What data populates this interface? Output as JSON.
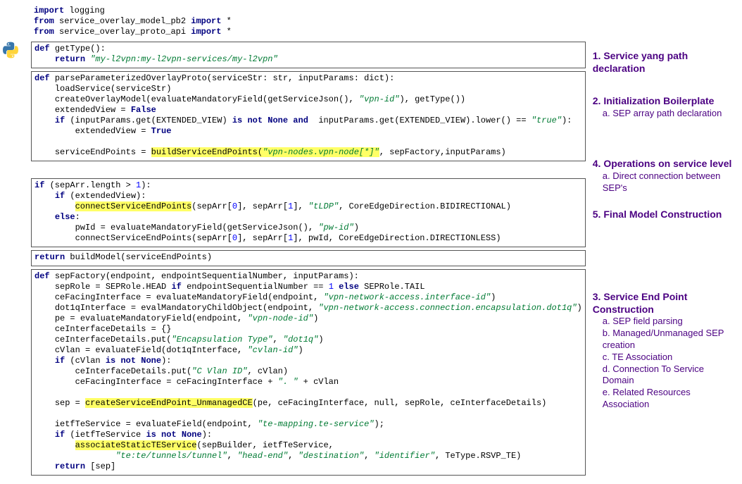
{
  "imports": {
    "l1": {
      "kw1": "import",
      "m": " logging"
    },
    "l2": {
      "kw1": "from",
      "m": " service_overlay_model_pb2 ",
      "kw2": "import",
      "star": " *"
    },
    "l3": {
      "kw1": "from",
      "m": " service_overlay_proto_api ",
      "kw2": "import",
      "star": " *"
    }
  },
  "box1": {
    "def": "def ",
    "fn": "getType",
    "sig": "():",
    "ret_kw": "return ",
    "ret_str": "\"my-l2vpn:my-l2vpn-services/my-l2vpn\""
  },
  "box2": {
    "def": "def ",
    "fn": "parseParameterizedOverlayProto",
    "sig": "(serviceStr: str, inputParams: dict):",
    "l1": "loadService(serviceStr)",
    "l2a": "createOverlayModel(evaluateMandatoryField(getServiceJson(), ",
    "l2s": "\"vpn-id\"",
    "l2b": "), getType())",
    "l3a": "extendedView = ",
    "l3kw": "False",
    "l4_if": "if ",
    "l4a": "(inputParams.get(EXTENDED_VIEW) ",
    "l4isnot": "is not ",
    "l4none": "None ",
    "l4and": "and  ",
    "l4b": "inputParams.get(EXTENDED_VIEW).lower() == ",
    "l4s": "\"true\"",
    "l4c": "):",
    "l5a": "extendedView = ",
    "l5kw": "True",
    "l6a": "serviceEndPoints = ",
    "l6hl": "buildServiceEndPoints(",
    "l6s": "\"vpn-nodes.vpn-node[*]\"",
    "l6b": ", sepFactory,inputParams)"
  },
  "box3": {
    "l1_if": "if ",
    "l1a": "(sepArr.length > ",
    "l1n": "1",
    "l1b": "):",
    "l2_if": "if ",
    "l2a": "(extendedView):",
    "l3hl": "connectServiceEndPoints",
    "l3a": "(sepArr[",
    "l3n0": "0",
    "l3b": "], sepArr[",
    "l3n1": "1",
    "l3c": "], ",
    "l3s": "\"tLDP\"",
    "l3d": ", CoreEdgeDirection.BIDIRECTIONAL)",
    "l4_else": "else",
    "l4a": ":",
    "l5a": "pwId = evaluateMandatoryField(getServiceJson(), ",
    "l5s": "\"pw-id\"",
    "l5b": ")",
    "l6a": "connectServiceEndPoints(sepArr[",
    "l6n0": "0",
    "l6b": "], sepArr[",
    "l6n1": "1",
    "l6c": "], pwId, CoreEdgeDirection.DIRECTIONLESS)"
  },
  "box4": {
    "ret_kw": "return ",
    "ret": "buildModel(serviceEndPoints)"
  },
  "fn3": {
    "def": "def ",
    "fn": "sepFactory",
    "sig": "(endpoint, endpointSequentialNumber, inputParams):",
    "l1a": "sepRole = SEPRole.HEAD ",
    "l1if": "if ",
    "l1b": "endpointSequentialNumber == ",
    "l1n": "1 ",
    "l1else": "else ",
    "l1c": "SEPRole.TAIL",
    "l2a": "ceFacingInterface = evaluateMandatoryField(endpoint, ",
    "l2s": "\"vpn-network-access.interface-id\"",
    "l2b": ")",
    "l3a": "dot1qInterface = evalMandatoryChildObject(endpoint, ",
    "l3s": "\"vpn-network-access.connection.encapsulation.dot1q\"",
    "l3b": ")",
    "l4a": "pe = evaluateMandatoryField(endpoint, ",
    "l4s": "\"vpn-node-id\"",
    "l4b": ")",
    "l5": "ceInterfaceDetails = {}",
    "l6a": "ceInterfaceDetails.put(",
    "l6s": "\"Encapsulation Type\"",
    "l6b": ", ",
    "l6s2": "\"dot1q\"",
    "l6c": ")",
    "l7a": "cVlan = evaluateField(dot1qInterface, ",
    "l7s": "\"cvlan-id\"",
    "l7b": ")",
    "l8_if": "if ",
    "l8a": "(cVlan ",
    "l8isnot": "is not ",
    "l8none": "None",
    "l8b": "):",
    "l9a": "ceInterfaceDetails.put(",
    "l9s": "\"C Vlan ID\"",
    "l9b": ", cVlan)",
    "l10a": "ceFacingInterface = ceFacingInterface + ",
    "l10s": "\". \"",
    "l10b": " + cVlan",
    "l11a": "sep = ",
    "l11hl": "createServiceEndPoint_UnmanagedCE",
    "l11b": "(pe, ceFacingInterface, null, sepRole, ceInterfaceDetails)",
    "l12a": "ietfTeService = evaluateField(endpoint, ",
    "l12s": "\"te-mapping.te-service\"",
    "l12b": ");",
    "l13_if": "if ",
    "l13a": "(ietfTeService ",
    "l13isnot": "is not ",
    "l13none": "None",
    "l13b": "):",
    "l14hl": "associateStaticTEService",
    "l14a": "(sepBuilder, ietfTeService,",
    "l15s1": "\"te:te/tunnels/tunnel\"",
    "l15a": ", ",
    "l15s2": "\"head-end\"",
    "l15b": ", ",
    "l15s3": "\"destination\"",
    "l15c": ", ",
    "l15s4": "\"identifier\"",
    "l15d": ", TeType.RSVP_TE)",
    "l16_ret": "return ",
    "l16a": "[sep]"
  },
  "anno": {
    "a1": "1. Service yang path declaration",
    "a2": "2. Initialization Boilerplate",
    "a2a": "a. SEP array path declaration",
    "a4": "4. Operations on service level",
    "a4a": "a. Direct connection between SEP's",
    "a5": "5. Final Model Construction",
    "a3": "3. Service End Point Construction",
    "a3a": "a. SEP field parsing",
    "a3b": "b. Managed/Unmanaged SEP creation",
    "a3c": "c. TE Association",
    "a3d": "d. Connection To Service Domain",
    "a3e": "e. Related Resources Association"
  }
}
